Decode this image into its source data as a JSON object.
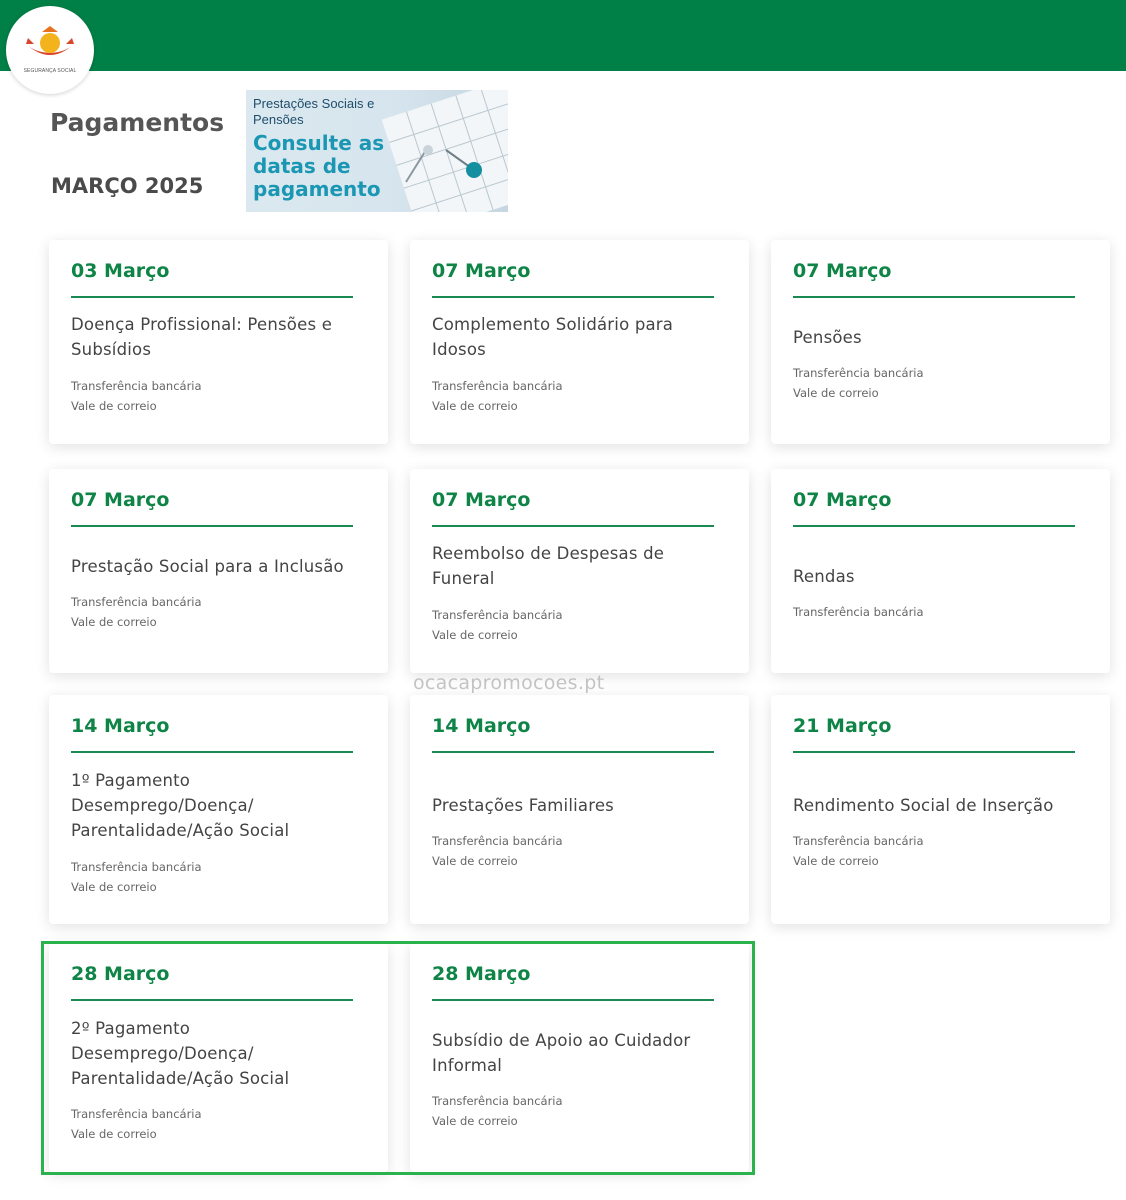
{
  "header": {
    "logo_text": "SEGURANÇA SOCIAL",
    "brand_color": "#008046"
  },
  "page": {
    "title": "Pagamentos",
    "month": "MARÇO 2025"
  },
  "banner": {
    "subtitle": "Prestações Sociais e Pensões",
    "headline": "Consulte as datas de pagamento"
  },
  "watermark": "ocacapromocoes.pt",
  "colors": {
    "accent_green": "#0e8446",
    "highlight_border": "#2bb24c"
  },
  "cards": [
    {
      "date": "03 Março",
      "title": "Doença Profissional: Pensões e Subsídios",
      "methods": [
        "Transferência bancária",
        "Vale de correio"
      ]
    },
    {
      "date": "07 Março",
      "title": "Complemento Solidário para Idosos",
      "methods": [
        "Transferência bancária",
        "Vale de correio"
      ]
    },
    {
      "date": "07 Março",
      "title": "Pensões",
      "methods": [
        "Transferência bancária",
        "Vale de correio"
      ]
    },
    {
      "date": "07 Março",
      "title": "Prestação Social para a Inclusão",
      "methods": [
        "Transferência bancária",
        "Vale de correio"
      ]
    },
    {
      "date": "07 Março",
      "title": "Reembolso de Despesas de Funeral",
      "methods": [
        "Transferência bancária",
        "Vale de correio"
      ]
    },
    {
      "date": "07 Março",
      "title": "Rendas",
      "methods": [
        "Transferência bancária"
      ]
    },
    {
      "date": "14 Março",
      "title": "1º Pagamento Desemprego/Doença/ Parentalidade/Ação Social",
      "methods": [
        "Transferência bancária",
        "Vale de correio"
      ]
    },
    {
      "date": "14 Março",
      "title": "Prestações Familiares",
      "methods": [
        "Transferência bancária",
        "Vale de correio"
      ]
    },
    {
      "date": "21 Março",
      "title": "Rendimento Social de Inserção",
      "methods": [
        "Transferência bancária",
        "Vale de correio"
      ]
    },
    {
      "date": "28 Março",
      "title": "2º Pagamento Desemprego/Doença/ Parentalidade/Ação Social",
      "methods": [
        "Transferência bancária",
        "Vale de correio"
      ]
    },
    {
      "date": "28 Março",
      "title": "Subsídio de Apoio ao Cuidador Informal",
      "methods": [
        "Transferência bancária",
        "Vale de correio"
      ]
    }
  ]
}
